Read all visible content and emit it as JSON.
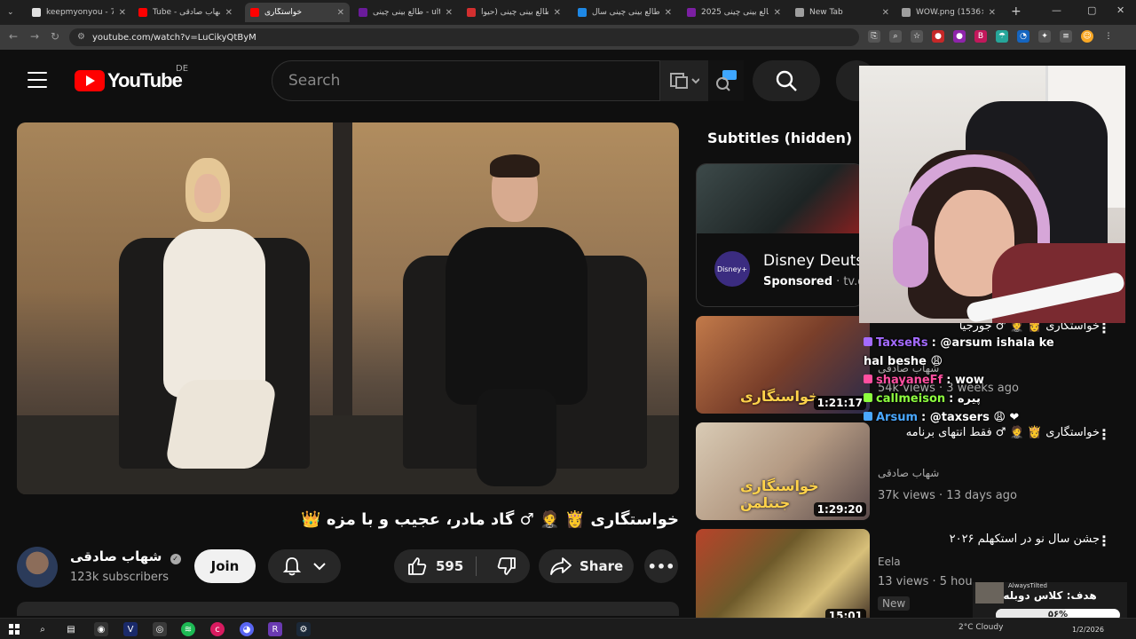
{
  "browser": {
    "tabs": [
      {
        "label": "keepmyonyou - 7TV",
        "color": "#e0e0e0"
      },
      {
        "label": "Tube - شهاب صادقی",
        "color": "#ff0000"
      },
      {
        "label": "خواستگاری",
        "color": "#ff0000"
      },
      {
        "label": "طالع بینی چینی - ults",
        "color": "#6a1b9a"
      },
      {
        "label": "طالع بینی چینی (حیوا",
        "color": "#d32f2f"
      },
      {
        "label": "طالع بینی چینی سال",
        "color": "#1e88e5"
      },
      {
        "label": "طالع بینی چینی 2025",
        "color": "#7b1fa2"
      },
      {
        "label": "New Tab",
        "color": "#9e9e9e"
      },
      {
        "label": "WOW.png (1536×10",
        "color": "#9e9e9e"
      }
    ],
    "url": "youtube.com/watch?v=LuCikyQtByM"
  },
  "header": {
    "logo_text": "YouTube",
    "region": "DE",
    "search_placeholder": "Search"
  },
  "video": {
    "title": "خواستگاری 👸 🤵 ♂ گاد مادر، عجیب و با مزه 👑",
    "channel_name": "شهاب صادقی",
    "subscribers": "123k subscribers",
    "join_label": "Join",
    "likes": "595",
    "share_label": "Share"
  },
  "sidebar": {
    "subtitles_heading": "Subtitles (hidden)",
    "ad": {
      "title": "Disney Deuts",
      "sponsored": "Sponsored",
      "domain": "· tv.dis",
      "logo_text": "Disney+"
    },
    "recommendations": [
      {
        "title": "خواستگاری 👸 🤵 ♂ جورجیا",
        "thumb_label": "خواستگاری",
        "channel": "شهاب صادقی",
        "meta": "54k views · 3 weeks ago",
        "duration": "1:21:17",
        "badge": ""
      },
      {
        "title": "خواستگاری 👸 🤵 ♂ فقط انتهای برنامه",
        "thumb_label": "خواستگاری جنتلمن",
        "channel": "شهاب صادقی",
        "meta": "37k views · 13 days ago",
        "duration": "1:29:20",
        "badge": ""
      },
      {
        "title": "جشن سال نو در استکهلم ۲۰۲۶",
        "thumb_label": "",
        "channel": "Eela",
        "meta": "13 views · 5 hou",
        "duration": "15:01",
        "badge": "New"
      }
    ]
  },
  "chat": [
    {
      "user": "TaxseRs",
      "color": "#a46bff",
      "text": "@arsum ishala ke hal beshe 😩"
    },
    {
      "user": "shayaneFf",
      "color": "#ff4fa0",
      "text": "wow"
    },
    {
      "user": "callmeison",
      "color": "#8dff3f",
      "text": "پیره"
    },
    {
      "user": "Arsum",
      "color": "#4aa8ff",
      "text": "@taxsers 😩 ❤"
    }
  ],
  "goal": {
    "title": "هدف: کلاس دوبله",
    "percent_label": "۵۶%",
    "percent": 56,
    "tag": "AlwaysTilted"
  },
  "taskbar": {
    "weather": "2°C Cloudy",
    "date": "1/2/2026"
  }
}
